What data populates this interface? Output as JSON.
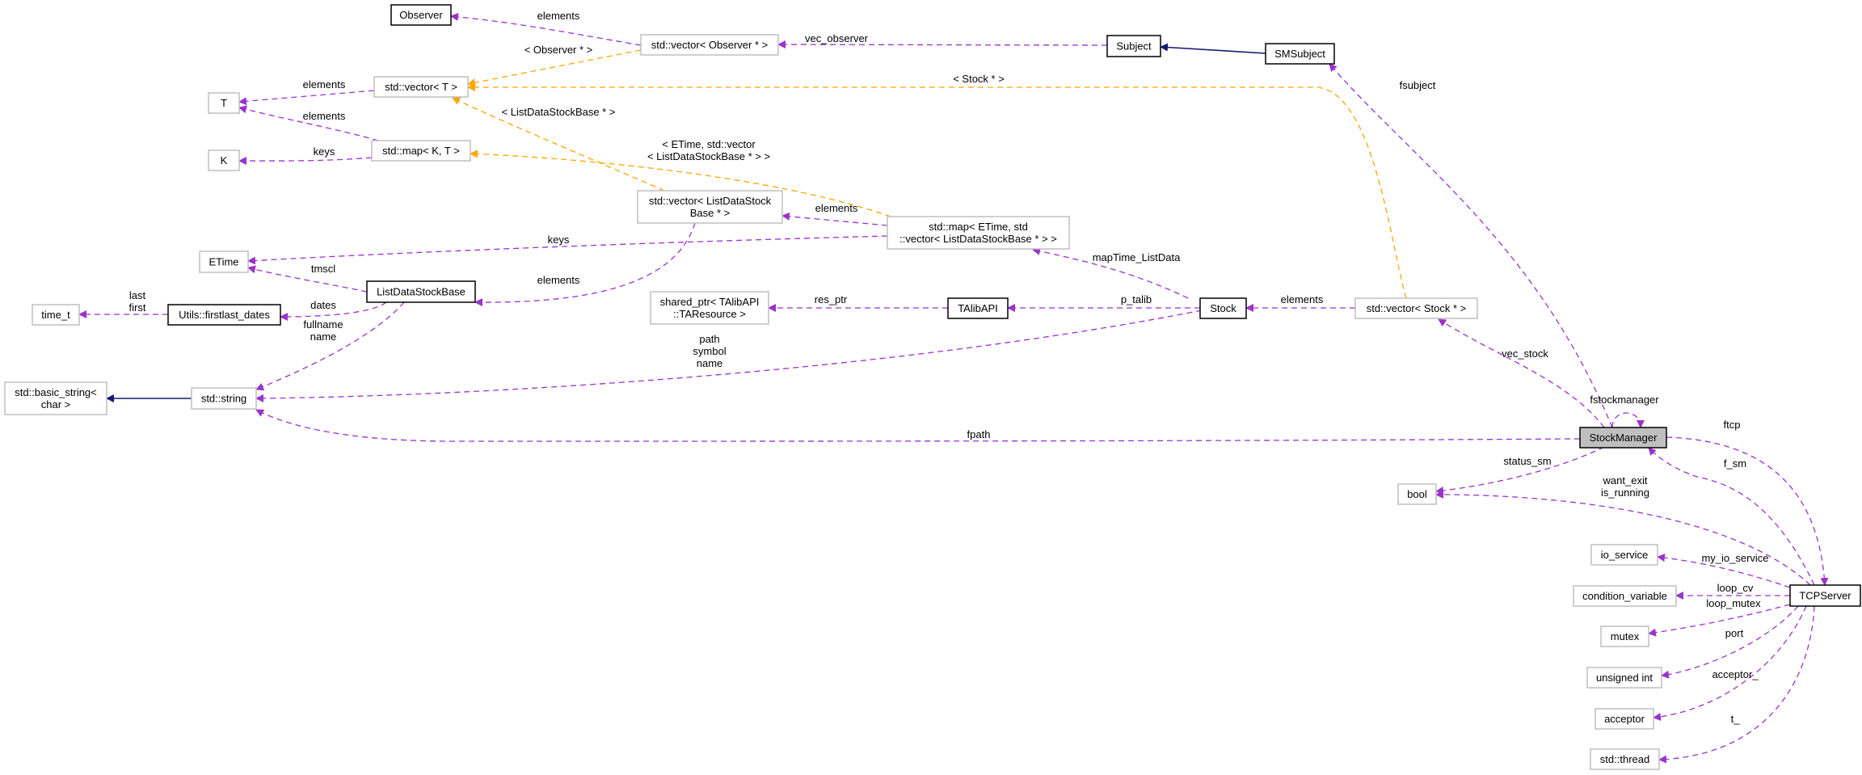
{
  "colors": {
    "member_edge": "#9a32cd",
    "template_edge": "#ffa500",
    "inherit_edge": "#191970",
    "highlight_fill": "#bfbfbf"
  },
  "nodes": [
    {
      "id": "observer",
      "lines": [
        "Observer"
      ],
      "style": "documented"
    },
    {
      "id": "vecObserver",
      "lines": [
        "std::vector< Observer * >"
      ],
      "style": "undocumented"
    },
    {
      "id": "subject",
      "lines": [
        "Subject"
      ],
      "style": "documented"
    },
    {
      "id": "smsubject",
      "lines": [
        "SMSubject"
      ],
      "style": "documented"
    },
    {
      "id": "vecT",
      "lines": [
        "std::vector< T >"
      ],
      "style": "undocumented"
    },
    {
      "id": "T",
      "lines": [
        "T"
      ],
      "style": "undocumented"
    },
    {
      "id": "mapKT",
      "lines": [
        "std::map< K, T >"
      ],
      "style": "undocumented"
    },
    {
      "id": "K",
      "lines": [
        "K"
      ],
      "style": "undocumented"
    },
    {
      "id": "vecLDSB",
      "lines": [
        "std::vector< ListDataStock",
        "Base * >"
      ],
      "style": "undocumented"
    },
    {
      "id": "mapETime",
      "lines": [
        "std::map< ETime, std",
        "::vector< ListDataStockBase * > >"
      ],
      "style": "undocumented"
    },
    {
      "id": "etime",
      "lines": [
        "ETime"
      ],
      "style": "undocumented"
    },
    {
      "id": "ldsb",
      "lines": [
        "ListDataStockBase"
      ],
      "style": "documented"
    },
    {
      "id": "utils",
      "lines": [
        "Utils::firstlast_dates"
      ],
      "style": "documented"
    },
    {
      "id": "timet",
      "lines": [
        "time_t"
      ],
      "style": "undocumented"
    },
    {
      "id": "sharedptr",
      "lines": [
        "shared_ptr< TAlibAPI",
        "::TAResource >"
      ],
      "style": "undocumented"
    },
    {
      "id": "talib",
      "lines": [
        "TAlibAPI"
      ],
      "style": "documented"
    },
    {
      "id": "stock",
      "lines": [
        "Stock"
      ],
      "style": "documented"
    },
    {
      "id": "vecStock",
      "lines": [
        "std::vector< Stock * >"
      ],
      "style": "undocumented"
    },
    {
      "id": "basicstring",
      "lines": [
        "std::basic_string<",
        "char >"
      ],
      "style": "undocumented"
    },
    {
      "id": "stdstring",
      "lines": [
        "std::string"
      ],
      "style": "undocumented"
    },
    {
      "id": "stockmanager",
      "lines": [
        "StockManager"
      ],
      "style": "highlight"
    },
    {
      "id": "bool",
      "lines": [
        "bool"
      ],
      "style": "undocumented"
    },
    {
      "id": "ioservice",
      "lines": [
        "io_service"
      ],
      "style": "undocumented"
    },
    {
      "id": "condvar",
      "lines": [
        "condition_variable"
      ],
      "style": "undocumented"
    },
    {
      "id": "mutex",
      "lines": [
        "mutex"
      ],
      "style": "undocumented"
    },
    {
      "id": "uint",
      "lines": [
        "unsigned int"
      ],
      "style": "undocumented"
    },
    {
      "id": "acceptor",
      "lines": [
        "acceptor"
      ],
      "style": "undocumented"
    },
    {
      "id": "thread",
      "lines": [
        "std::thread"
      ],
      "style": "undocumented"
    },
    {
      "id": "tcpserver",
      "lines": [
        "TCPServer"
      ],
      "style": "documented"
    }
  ],
  "edges": [
    {
      "from": "vecObserver",
      "to": "observer",
      "kind": "member",
      "label": [
        "elements"
      ]
    },
    {
      "from": "subject",
      "to": "vecObserver",
      "kind": "member",
      "label": [
        "vec_observer"
      ]
    },
    {
      "from": "vecObserver",
      "to": "vecT",
      "kind": "template",
      "label": [
        "< Observer * >"
      ]
    },
    {
      "from": "smsubject",
      "to": "subject",
      "kind": "inherit",
      "label": []
    },
    {
      "from": "vecStock",
      "to": "vecT",
      "kind": "template",
      "label": [
        "< Stock * >"
      ]
    },
    {
      "from": "vecT",
      "to": "T",
      "kind": "member",
      "label": [
        "elements"
      ]
    },
    {
      "from": "mapKT",
      "to": "T",
      "kind": "member",
      "label": [
        "elements"
      ]
    },
    {
      "from": "mapKT",
      "to": "K",
      "kind": "member",
      "label": [
        "keys"
      ]
    },
    {
      "from": "vecLDSB",
      "to": "vecT",
      "kind": "template",
      "label": [
        "< ListDataStockBase * >"
      ]
    },
    {
      "from": "mapETime",
      "to": "mapKT",
      "kind": "template",
      "label": [
        "< ETime, std::vector",
        "< ListDataStockBase * > >"
      ]
    },
    {
      "from": "mapETime",
      "to": "vecLDSB",
      "kind": "member",
      "label": [
        "elements"
      ]
    },
    {
      "from": "mapETime",
      "to": "etime",
      "kind": "member",
      "label": [
        "keys"
      ]
    },
    {
      "from": "vecLDSB",
      "to": "ldsb",
      "kind": "member",
      "label": [
        "elements"
      ]
    },
    {
      "from": "ldsb",
      "to": "etime",
      "kind": "member",
      "label": [
        "tmscl"
      ]
    },
    {
      "from": "ldsb",
      "to": "utils",
      "kind": "member",
      "label": [
        "dates"
      ]
    },
    {
      "from": "utils",
      "to": "timet",
      "kind": "member",
      "label": [
        "last",
        "first"
      ]
    },
    {
      "from": "ldsb",
      "to": "stdstring",
      "kind": "member",
      "label": [
        "fullname",
        "name"
      ]
    },
    {
      "from": "stock",
      "to": "stdstring",
      "kind": "member",
      "label": [
        "path",
        "symbol",
        "name"
      ]
    },
    {
      "from": "stdstring",
      "to": "basicstring",
      "kind": "inherit",
      "label": []
    },
    {
      "from": "stock",
      "to": "mapETime",
      "kind": "member",
      "label": [
        "mapTime_ListData"
      ]
    },
    {
      "from": "stock",
      "to": "talib",
      "kind": "member",
      "label": [
        "p_talib"
      ]
    },
    {
      "from": "talib",
      "to": "sharedptr",
      "kind": "member",
      "label": [
        "res_ptr"
      ]
    },
    {
      "from": "vecStock",
      "to": "stock",
      "kind": "member",
      "label": [
        "elements"
      ]
    },
    {
      "from": "stockmanager",
      "to": "vecStock",
      "kind": "member",
      "label": [
        "vec_stock"
      ]
    },
    {
      "from": "stockmanager",
      "to": "smsubject",
      "kind": "member",
      "label": [
        "fsubject"
      ]
    },
    {
      "from": "stockmanager",
      "to": "stockmanager",
      "kind": "member",
      "label": [
        "fstockmanager"
      ]
    },
    {
      "from": "stockmanager",
      "to": "stdstring",
      "kind": "member",
      "label": [
        "fpath"
      ]
    },
    {
      "from": "stockmanager",
      "to": "bool",
      "kind": "member",
      "label": [
        "status_sm"
      ]
    },
    {
      "from": "stockmanager",
      "to": "tcpserver",
      "kind": "member",
      "label": [
        "ftcp"
      ]
    },
    {
      "from": "tcpserver",
      "to": "stockmanager",
      "kind": "member",
      "label": [
        "f_sm"
      ]
    },
    {
      "from": "tcpserver",
      "to": "bool",
      "kind": "member",
      "label": [
        "want_exit",
        "is_running"
      ]
    },
    {
      "from": "tcpserver",
      "to": "ioservice",
      "kind": "member",
      "label": [
        "my_io_service"
      ]
    },
    {
      "from": "tcpserver",
      "to": "condvar",
      "kind": "member",
      "label": [
        "loop_cv"
      ]
    },
    {
      "from": "tcpserver",
      "to": "mutex",
      "kind": "member",
      "label": [
        "loop_mutex"
      ]
    },
    {
      "from": "tcpserver",
      "to": "uint",
      "kind": "member",
      "label": [
        "port"
      ]
    },
    {
      "from": "tcpserver",
      "to": "acceptor",
      "kind": "member",
      "label": [
        "acceptor_"
      ]
    },
    {
      "from": "tcpserver",
      "to": "thread",
      "kind": "member",
      "label": [
        "t_"
      ]
    }
  ]
}
